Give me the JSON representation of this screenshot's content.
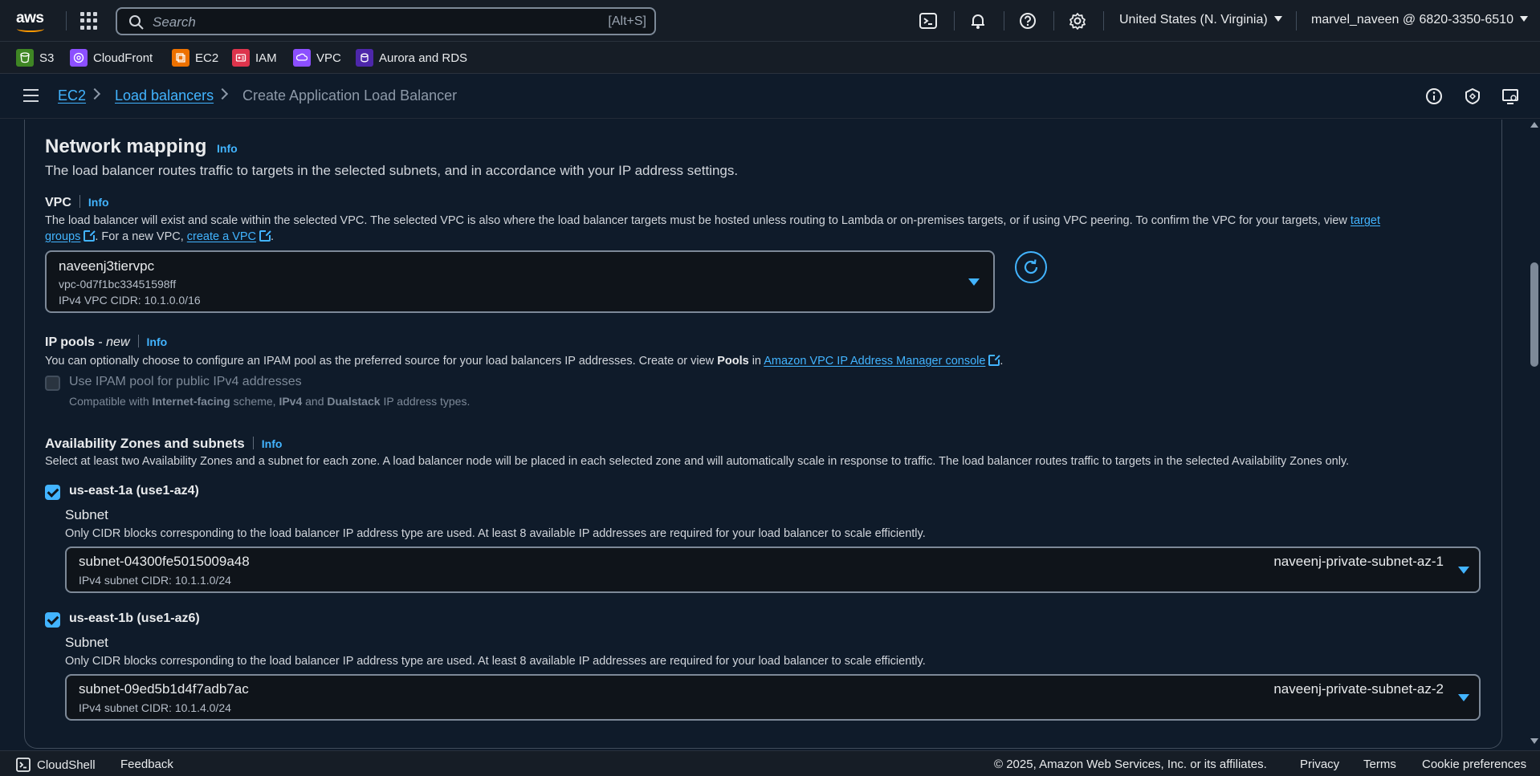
{
  "topbar": {
    "logo_text": "aws",
    "search_placeholder": "Search",
    "search_shortcut": "[Alt+S]",
    "region": "United States (N. Virginia)",
    "account": "marvel_naveen @ 6820-3350-6510"
  },
  "favorites": [
    {
      "label": "S3",
      "color": "#3f8624"
    },
    {
      "label": "CloudFront",
      "color": "#8c4fff"
    },
    {
      "label": "EC2",
      "color": "#ed7100"
    },
    {
      "label": "IAM",
      "color": "#dd344c"
    },
    {
      "label": "VPC",
      "color": "#8c4fff"
    },
    {
      "label": "Aurora and RDS",
      "color": "#4d27aa"
    }
  ],
  "breadcrumb": {
    "items": [
      "EC2",
      "Load balancers"
    ],
    "current": "Create Application Load Balancer"
  },
  "network_mapping": {
    "title": "Network mapping",
    "info": "Info",
    "description": "The load balancer routes traffic to targets in the selected subnets, and in accordance with your IP address settings."
  },
  "vpc": {
    "label": "VPC",
    "info": "Info",
    "description_part1": "The load balancer will exist and scale within the selected VPC. The selected VPC is also where the load balancer targets must be hosted unless routing to Lambda or on-premises targets, or if using VPC peering. To confirm the VPC for your targets, view",
    "link_target": "target",
    "link_groups": "groups",
    "description_part2": ". For a new VPC,",
    "link_create": "create a VPC",
    "period": ".",
    "selected_name": "naveenj3tiervpc",
    "selected_id": "vpc-0d7f1bc33451598ff",
    "selected_cidr": "IPv4 VPC CIDR: 10.1.0.0/16"
  },
  "ip_pools": {
    "label": "IP pools",
    "label_suffix": " - ",
    "new_tag": "new",
    "info": "Info",
    "description_part1": "You can optionally choose to configure an IPAM pool as the preferred source for your load balancers IP addresses. Create or view",
    "bold_pools": "Pools",
    "description_in": "in",
    "link_ipam": "Amazon VPC IP Address Manager console",
    "period": ".",
    "checkbox_label": "Use IPAM pool for public IPv4 addresses",
    "checkbox_checked": false,
    "hint_1": "Compatible with",
    "hint_b1": "Internet-facing",
    "hint_2": "scheme,",
    "hint_b2": "IPv4",
    "hint_3": "and",
    "hint_b3": "Dualstack",
    "hint_4": "IP address types."
  },
  "az": {
    "label": "Availability Zones and subnets",
    "info": "Info",
    "description": "Select at least two Availability Zones and a subnet for each zone. A load balancer node will be placed in each selected zone and will automatically scale in response to traffic. The load balancer routes traffic to targets in the selected Availability Zones only.",
    "zones": [
      {
        "name": "us-east-1a (use1-az4)",
        "checked": true,
        "subnet_label": "Subnet",
        "subnet_hint": "Only CIDR blocks corresponding to the load balancer IP address type are used. At least 8 available IP addresses are required for your load balancer to scale efficiently.",
        "subnet_id": "subnet-04300fe5015009a48",
        "subnet_cidr": "IPv4 subnet CIDR: 10.1.1.0/24",
        "subnet_name": "naveenj-private-subnet-az-1"
      },
      {
        "name": "us-east-1b (use1-az6)",
        "checked": true,
        "subnet_label": "Subnet",
        "subnet_hint": "Only CIDR blocks corresponding to the load balancer IP address type are used. At least 8 available IP addresses are required for your load balancer to scale efficiently.",
        "subnet_id": "subnet-09ed5b1d4f7adb7ac",
        "subnet_cidr": "IPv4 subnet CIDR: 10.1.4.0/24",
        "subnet_name": "naveenj-private-subnet-az-2"
      }
    ]
  },
  "footer": {
    "cloudshell": "CloudShell",
    "feedback": "Feedback",
    "copyright": "© 2025, Amazon Web Services, Inc. or its affiliates.",
    "privacy": "Privacy",
    "terms": "Terms",
    "cookies": "Cookie preferences"
  }
}
